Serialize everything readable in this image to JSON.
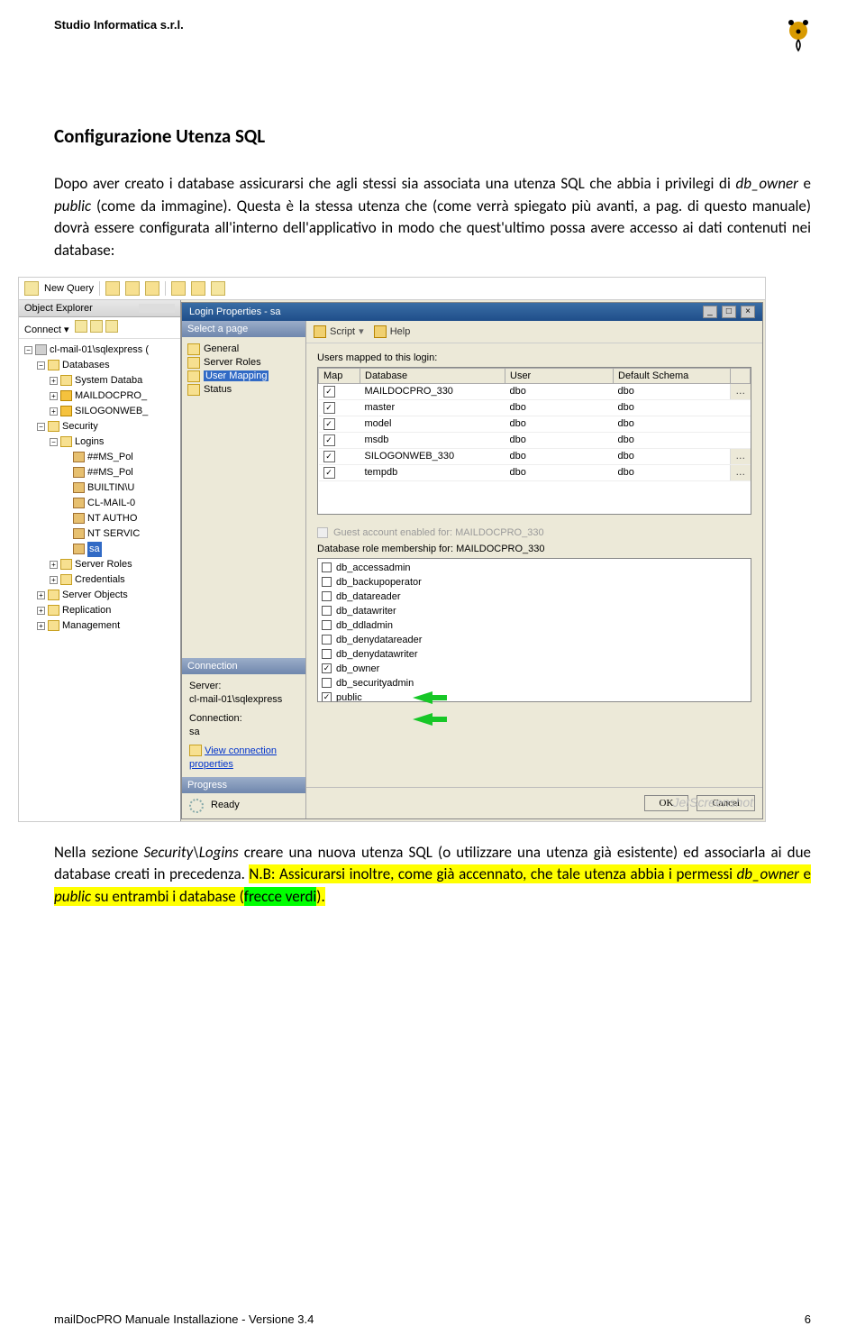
{
  "header": {
    "company": "Studio Informatica s.r.l."
  },
  "title": "Configurazione Utenza SQL",
  "para1_a": "Dopo aver creato i database assicurarsi che agli stessi sia associata una utenza SQL che abbia i privilegi di ",
  "para1_b": "db_owner",
  "para1_c": " e ",
  "para1_d": "public",
  "para1_e": " (come da immagine). Questa è la stessa utenza che (come verrà spiegato più avanti, a pag. di questo manuale) dovrà essere configurata all'interno dell'applicativo in modo che quest'ultimo possa avere accesso ai dati contenuti nei database:",
  "screenshot": {
    "toolbar": {
      "new_query": "New Query"
    },
    "object_explorer": {
      "title": "Object Explorer",
      "connect": "Connect ▾",
      "tree": {
        "server": "cl-mail-01\\sqlexpress (",
        "databases": "Databases",
        "db_items": [
          "System Databa",
          "MAILDOCPRO_",
          "SILOGONWEB_"
        ],
        "security": "Security",
        "logins": "Logins",
        "login_items": [
          "##MS_Pol",
          "##MS_Pol",
          "BUILTIN\\U",
          "CL-MAIL-0",
          "NT AUTHO",
          "NT SERVIC",
          "sa"
        ],
        "server_roles": "Server Roles",
        "credentials": "Credentials",
        "server_objects": "Server Objects",
        "replication": "Replication",
        "management": "Management"
      }
    },
    "dialog": {
      "title": "Login Properties - sa",
      "pages_hd": "Select a page",
      "pages": [
        "General",
        "Server Roles",
        "User Mapping",
        "Status"
      ],
      "connection_hd": "Connection",
      "connection": {
        "server_lbl": "Server:",
        "server_val": "cl-mail-01\\sqlexpress",
        "conn_lbl": "Connection:",
        "conn_val": "sa",
        "view_props": "View connection properties"
      },
      "progress_hd": "Progress",
      "progress_val": "Ready",
      "right": {
        "script": "Script",
        "help": "Help",
        "users_mapped": "Users mapped to this login:",
        "cols": {
          "map": "Map",
          "db": "Database",
          "user": "User",
          "schema": "Default Schema"
        },
        "rows": [
          {
            "db": "MAILDOCPRO_330",
            "user": "dbo",
            "schema": "dbo",
            "ell": true
          },
          {
            "db": "master",
            "user": "dbo",
            "schema": "dbo"
          },
          {
            "db": "model",
            "user": "dbo",
            "schema": "dbo"
          },
          {
            "db": "msdb",
            "user": "dbo",
            "schema": "dbo"
          },
          {
            "db": "SILOGONWEB_330",
            "user": "dbo",
            "schema": "dbo",
            "ell": true
          },
          {
            "db": "tempdb",
            "user": "dbo",
            "schema": "dbo",
            "ell": true
          }
        ],
        "guest_disabled": "Guest account enabled for: MAILDOCPRO_330",
        "role_membership": "Database role membership for: MAILDOCPRO_330",
        "roles": [
          {
            "name": "db_accessadmin",
            "checked": false
          },
          {
            "name": "db_backupoperator",
            "checked": false
          },
          {
            "name": "db_datareader",
            "checked": false
          },
          {
            "name": "db_datawriter",
            "checked": false
          },
          {
            "name": "db_ddladmin",
            "checked": false
          },
          {
            "name": "db_denydatareader",
            "checked": false
          },
          {
            "name": "db_denydatawriter",
            "checked": false
          },
          {
            "name": "db_owner",
            "checked": true
          },
          {
            "name": "db_securityadmin",
            "checked": false
          },
          {
            "name": "public",
            "checked": true
          }
        ],
        "ok": "OK",
        "cancel": "Cancel"
      }
    },
    "watermark": "JetScreenshot"
  },
  "para2_a": "Nella sezione ",
  "para2_b": "Security\\Logins",
  "para2_c": " creare una nuova utenza SQL (o utilizzare una utenza già esistente) ed associarla ai due database creati in precedenza. ",
  "para2_d": "N.B: Assicurarsi inoltre, come già accennato, che tale utenza abbia i permessi ",
  "para2_e": "db_owner",
  "para2_f": " e ",
  "para2_g": "public",
  "para2_h": " su entrambi i database (",
  "para2_i": "frecce verdi",
  "para2_j": ").",
  "footer": {
    "doc": "mailDocPRO Manuale Installazione - Versione 3.4",
    "page": "6"
  }
}
